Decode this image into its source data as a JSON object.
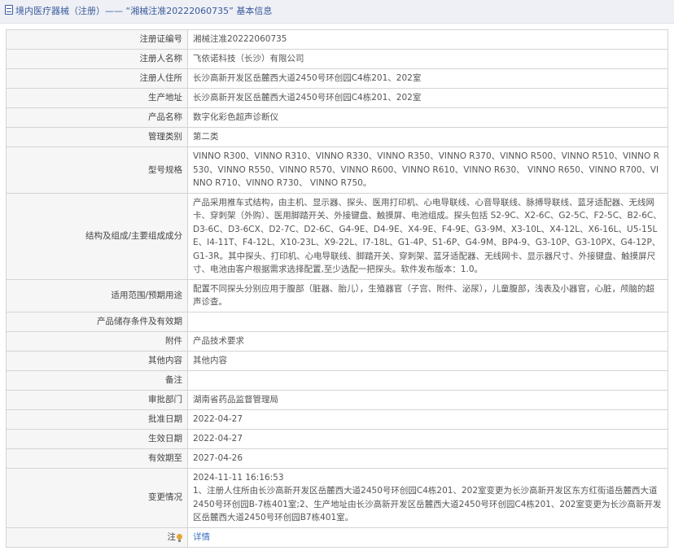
{
  "header": {
    "title": "境内医疗器械（注册）—— “湘械注准20222060735” 基本信息"
  },
  "rows": [
    {
      "label": "注册证编号",
      "value": "湘械注准20222060735"
    },
    {
      "label": "注册人名称",
      "value": "飞依诺科技（长沙）有限公司"
    },
    {
      "label": "注册人住所",
      "value": "长沙高新开发区岳麓西大道2450号环创园C4栋201、202室"
    },
    {
      "label": "生产地址",
      "value": "长沙高新开发区岳麓西大道2450号环创园C4栋201、202室"
    },
    {
      "label": "产品名称",
      "value": "数字化彩色超声诊断仪"
    },
    {
      "label": "管理类别",
      "value": "第二类"
    },
    {
      "label": "型号规格",
      "value": "VINNO R300、VINNO R310、VINNO R330、VINNO R350、VINNO R370、VINNO R500、VINNO R510、VINNO R530、VINNO R550、VINNO R570、VINNO R600、VINNO R610、VINNO R630、 VINNO R650、VINNO R700、VINNO R710、VINNO R730、 VINNO R750。"
    },
    {
      "label": "结构及组成/主要组成成分",
      "value": "产品采用推车式结构，由主机、显示器、探头、医用打印机、心电导联线、心音导联线、脉搏导联线、蓝牙适配器、无线网卡、穿刺架（外购）、医用脚踏开关、外接键盘、触摸屏、电池组成。探头包括 S2-9C、X2-6C、G2-5C、F2-5C、B2-6C、D3-6C、D3-6CX、D2-7C、D2-6C、G4-9E、D4-9E、X4-9E、F4-9E、G3-9M、X3-10L、X4-12L、X6-16L、U5-15LE、I4-11T、F4-12L、X10-23L、X9-22L、I7-18L、G1-4P、S1-6P、G4-9M、BP4-9、G3-10P、G3-10PX、G4-12P、G1-3R。其中探头、打印机、心电导联线、脚踏开关、穿刺架、蓝牙适配器、无线网卡、显示器尺寸、外接键盘、触摸屏尺寸、电池由客户根据需求选择配置,至少选配一把探头。软件发布版本：1.0。"
    },
    {
      "label": "适用范围/预期用途",
      "value": "配置不同探头分别应用于腹部（脏器、胎儿），生殖器官（子宫、附件、泌尿），儿童腹部，浅表及小器官，心脏，颅脑的超声诊查。"
    },
    {
      "label": "产品储存条件及有效期",
      "value": ""
    },
    {
      "label": "附件",
      "value": "产品技术要求"
    },
    {
      "label": "其他内容",
      "value": "其他内容"
    },
    {
      "label": "备注",
      "value": ""
    },
    {
      "label": "审批部门",
      "value": "湖南省药品监督管理局"
    },
    {
      "label": "批准日期",
      "value": "2022-04-27"
    },
    {
      "label": "生效日期",
      "value": "2022-04-27"
    },
    {
      "label": "有效期至",
      "value": "2027-04-26"
    }
  ],
  "change": {
    "label": "变更情况",
    "date": "2024-11-11 16:16:53",
    "text": "1、注册人住所由长沙高新开发区岳麓西大道2450号环创园C4栋201、202室变更为长沙高新开发区东方红街道岳麓西大道2450号环创园B-7栋401室;2、生产地址由长沙高新开发区岳麓西大道2450号环创园C4栋201、202室变更为长沙高新开发区岳麓西大道2450号环创园B7栋401室。"
  },
  "note": {
    "label": "注",
    "link_text": "详情",
    "icon": "lightbulb-icon",
    "icon_color": "#e4a536"
  }
}
